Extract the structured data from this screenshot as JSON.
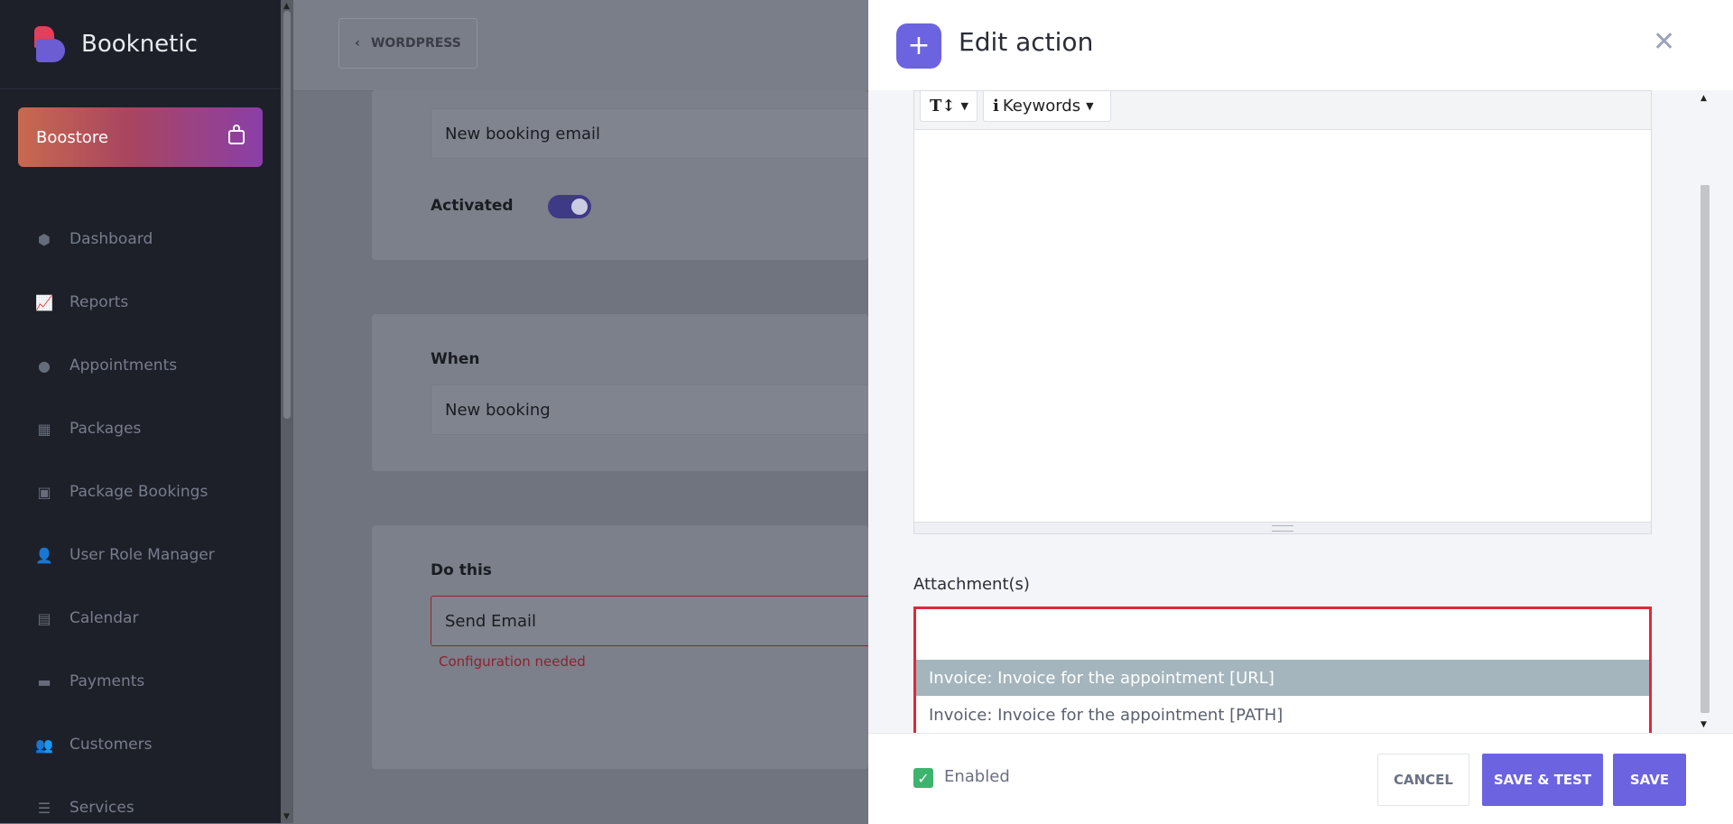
{
  "sidebar": {
    "brand": "Booknetic",
    "boostore": "Boostore",
    "items": [
      {
        "label": "Dashboard",
        "icon": "cube-icon"
      },
      {
        "label": "Reports",
        "icon": "chart-icon"
      },
      {
        "label": "Appointments",
        "icon": "clock-icon"
      },
      {
        "label": "Packages",
        "icon": "boxes-icon"
      },
      {
        "label": "Package Bookings",
        "icon": "box-open-icon"
      },
      {
        "label": "User Role Manager",
        "icon": "user-plus-icon"
      },
      {
        "label": "Calendar",
        "icon": "calendar-check-icon"
      },
      {
        "label": "Payments",
        "icon": "wallet-icon"
      },
      {
        "label": "Customers",
        "icon": "users-icon"
      },
      {
        "label": "Services",
        "icon": "list-icon"
      }
    ]
  },
  "content": {
    "back_button": "WORDPRESS",
    "name_value": "New booking email",
    "activated_label": "Activated",
    "when_label": "When",
    "when_value": "New booking",
    "do_this_label": "Do this",
    "do_this_value": "Send Email",
    "config_error": "Configuration needed"
  },
  "panel": {
    "title": "Edit action",
    "toolbar": {
      "text_format": "T↕",
      "keywords": "Keywords"
    },
    "attachment_label": "Attachment(s)",
    "attachment_options": [
      "Invoice: Invoice for the appointment [URL]",
      "Invoice: Invoice for the appointment [PATH]"
    ],
    "enabled_label": "Enabled",
    "cancel": "CANCEL",
    "save_test": "SAVE & TEST",
    "save": "SAVE"
  },
  "colors": {
    "accent": "#6c63e0",
    "error": "#e0283a",
    "success": "#3db46d",
    "sidebar_bg": "#1d2029"
  }
}
